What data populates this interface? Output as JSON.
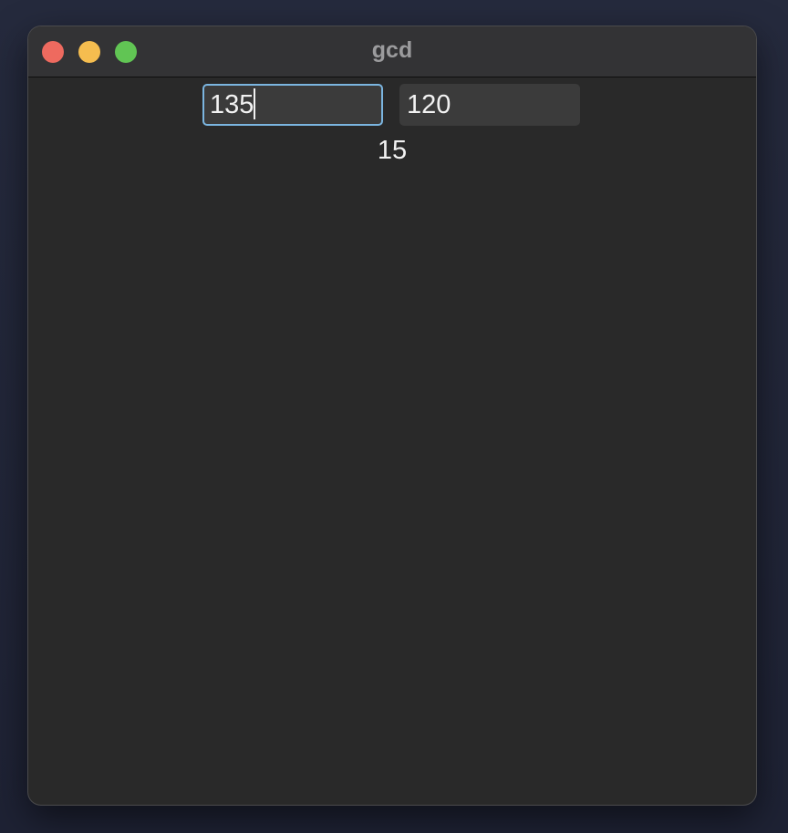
{
  "window": {
    "title": "gcd"
  },
  "inputs": {
    "first_value": "135",
    "second_value": "120"
  },
  "result": {
    "value": "15"
  },
  "colors": {
    "close": "#ee6a5f",
    "minimize": "#f5bd4f",
    "zoom": "#61c554",
    "focus_ring": "#7bb5e0",
    "window_bg": "#292929"
  }
}
